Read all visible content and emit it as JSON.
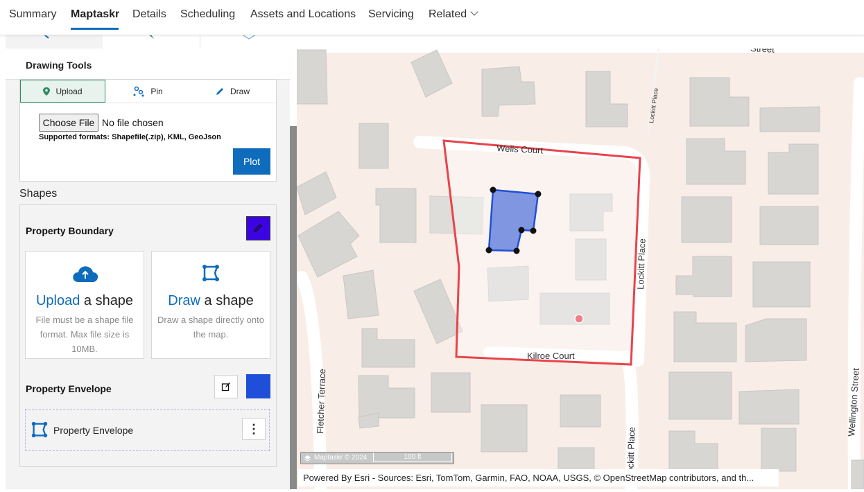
{
  "nav": {
    "tabs": [
      {
        "label": "Summary"
      },
      {
        "label": "Maptaskr"
      },
      {
        "label": "Details"
      },
      {
        "label": "Scheduling"
      },
      {
        "label": "Assets and Locations"
      },
      {
        "label": "Servicing"
      },
      {
        "label": "Related"
      }
    ],
    "active_tab": "Maptaskr"
  },
  "panel": {
    "title": "Drawing Tools",
    "tools": [
      {
        "label": "Upload",
        "icon": "map-marker-icon",
        "active": true
      },
      {
        "label": "Pin",
        "icon": "pins-icon",
        "active": false
      },
      {
        "label": "Draw",
        "icon": "pencil-icon",
        "active": false
      }
    ],
    "choose_file": "Choose File",
    "no_file": "No file chosen",
    "formats": "Supported formats: Shapefile(.zip), KML, GeoJson",
    "plot": "Plot"
  },
  "shapes": {
    "label": "Shapes",
    "boundary": {
      "title": "Property Boundary",
      "color": "#3a05e0",
      "upload_card": {
        "link": "Upload",
        "rest": " a shape",
        "desc": "File must be a shape file format. Max file size is 10MB."
      },
      "draw_card": {
        "link": "Draw",
        "rest": " a shape",
        "desc": "Draw a shape directly onto the map."
      }
    },
    "envelope": {
      "title": "Property Envelope",
      "color": "#1f4fd8",
      "item_label": "Property Envelope"
    }
  },
  "map": {
    "street_labels": [
      "Wells Court",
      "Kilroe Court",
      "Lockitt Place",
      "Lockitt Place",
      "Fletcher Terrace",
      "Wellington Street",
      "Street",
      "Lockitt Place"
    ],
    "scale_brand": "Maptaskr © 2024",
    "scale_label": "100 ft",
    "attribution": "Powered By Esri - Sources: Esri, TomTom, Garmin, FAO, NOAA, USGS, © OpenStreetMap contributors, and th...",
    "colors": {
      "background": "#f9ede7",
      "road": "#ffffff",
      "building": "#d8d6d3",
      "boundary": "#e8434b",
      "envelope_fill": "#8096e0",
      "envelope_stroke": "#1f4fd8"
    }
  }
}
